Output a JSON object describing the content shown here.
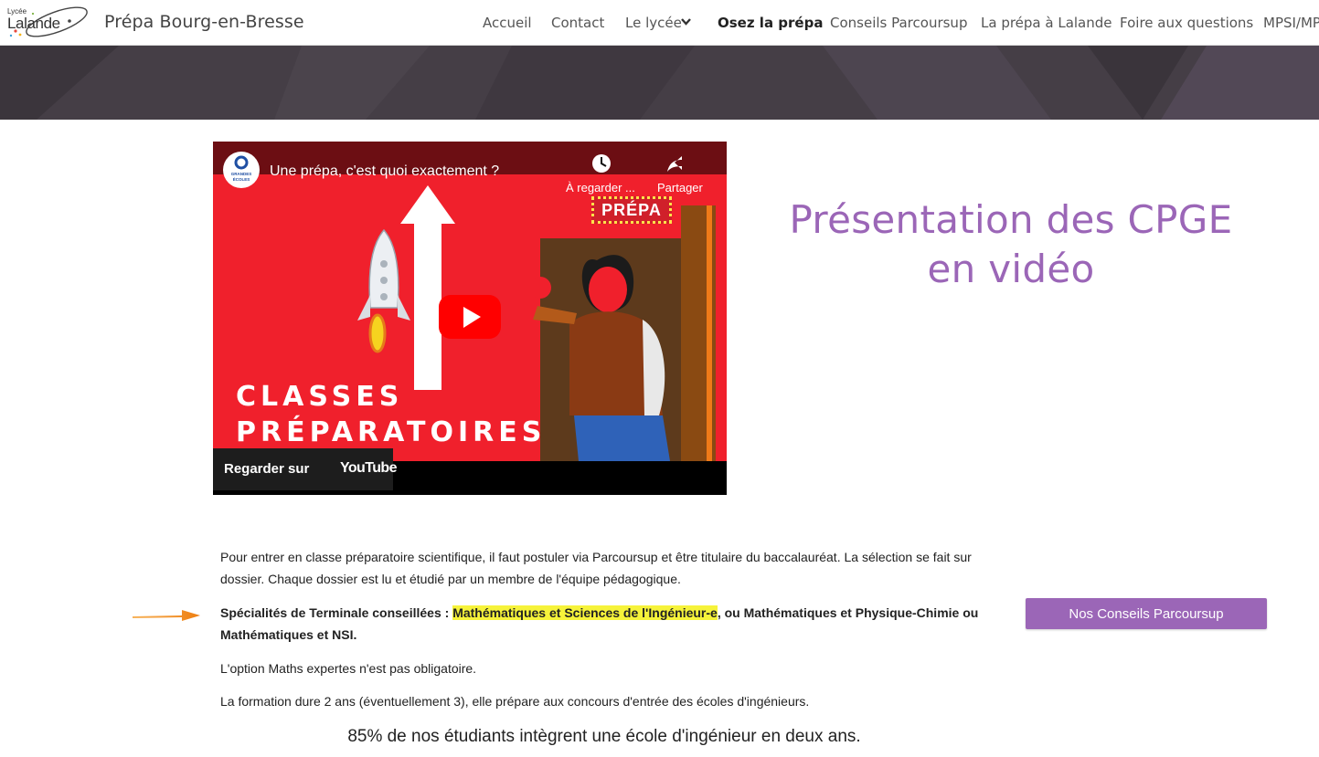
{
  "header": {
    "logo_small": "Lycée",
    "logo_main": "Lalande",
    "site_title": "Prépa Bourg-en-Bresse",
    "nav": [
      {
        "label": "Accueil"
      },
      {
        "label": "Contact"
      },
      {
        "label": "Le lycée"
      },
      {
        "label": "Osez la prépa",
        "active": true
      },
      {
        "label": "Conseils Parcoursup"
      },
      {
        "label": "La prépa à Lalande"
      },
      {
        "label": "Foire aux questions"
      },
      {
        "label": "MPSI/MP"
      }
    ]
  },
  "video": {
    "channel_badge_line1": "GRANDES",
    "channel_badge_line2": "ÉCOLES",
    "title": "Une prépa, c'est quoi exactement ?",
    "watch_later": "À regarder ...",
    "share": "Partager",
    "sign": "PRÉPA",
    "overlay_line1": "CLASSES",
    "overlay_line2": "PRÉPARATOIRES",
    "watch_on": "Regarder sur",
    "youtube": "YouTube"
  },
  "section": {
    "heading": "Présentation des CPGE en vidéo"
  },
  "content": {
    "p1": "Pour entrer en classe préparatoire scientifique, il faut postuler via Parcoursup et être titulaire du baccalauréat. La sélection se fait sur dossier. Chaque dossier est lu et étudié par un membre de l'équipe pédagogique.",
    "p2_prefix": "Spécialités de Terminale conseillées : ",
    "p2_highlight": "Mathématiques et Sciences de l'Ingénieur-e",
    "p2_suffix": ", ou Mathématiques et Physique-Chimie ou Mathématiques et NSI.",
    "p3": "L'option Maths expertes n'est pas obligatoire.",
    "p4": "La formation dure 2 ans (éventuellement 3), elle prépare aux concours d'entrée des écoles d'ingénieurs.",
    "closing": "85% de nos étudiants intègrent une école d'ingénieur en deux ans."
  },
  "cta": {
    "label": "Nos Conseils Parcoursup"
  },
  "colors": {
    "accent": "#9b66b7",
    "highlight": "#f6f33a",
    "banner": "#443d45",
    "video_red": "#f0202c",
    "arrow": "#f08a1c"
  }
}
